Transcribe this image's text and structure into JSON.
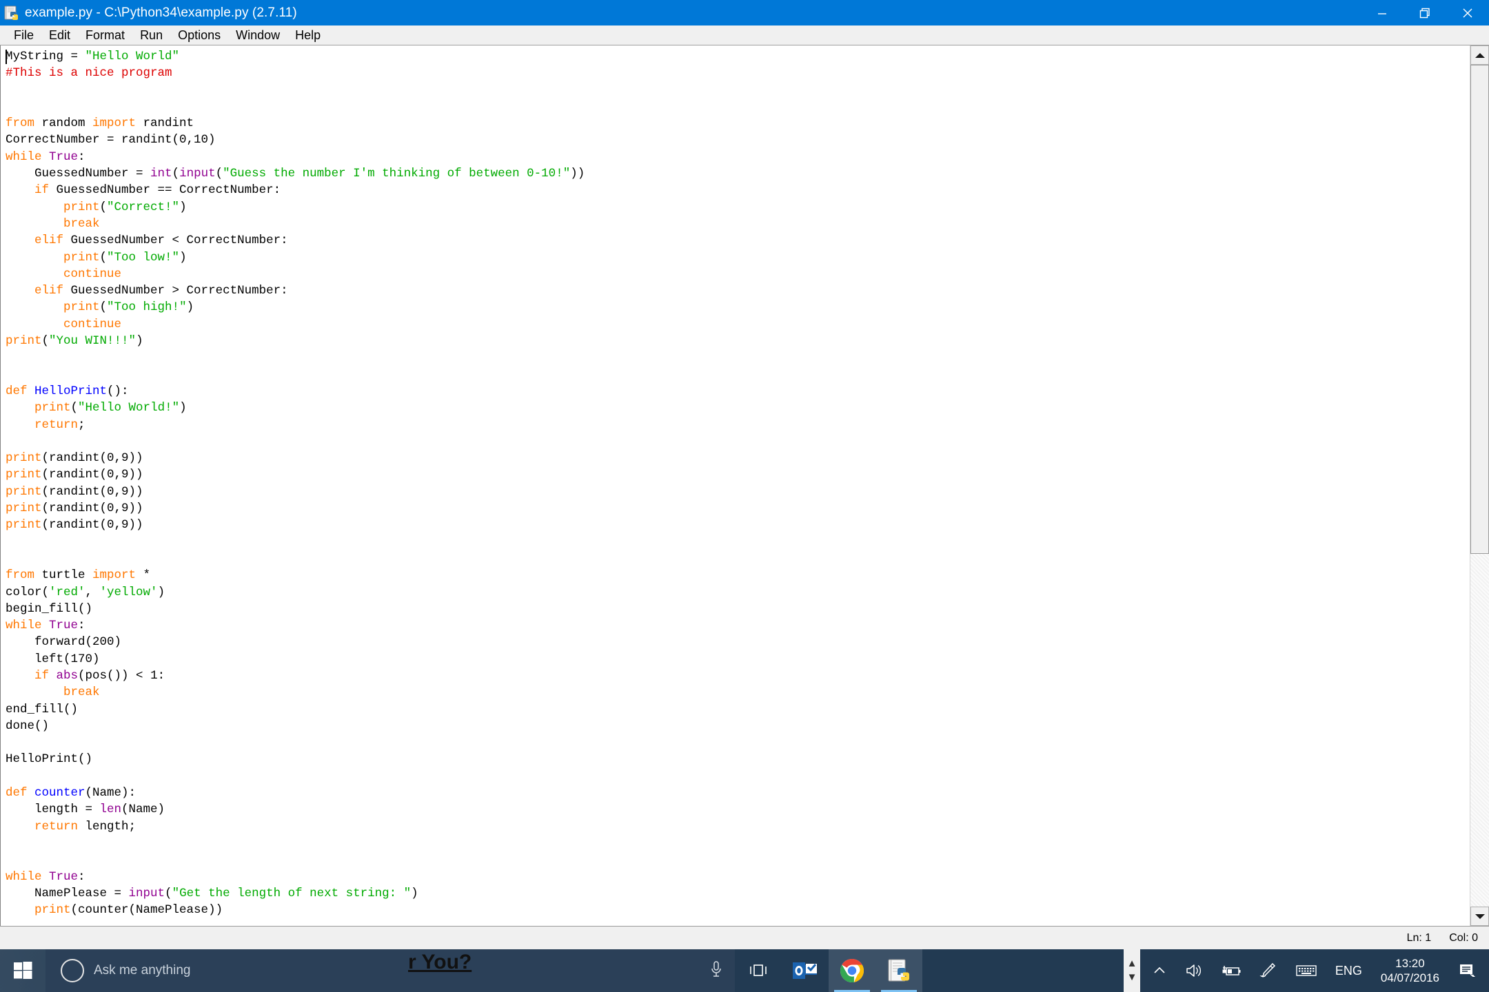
{
  "window": {
    "title": "example.py - C:\\Python34\\example.py (2.7.11)",
    "app_icon": "python-idle-icon",
    "controls": {
      "minimize": "Minimize",
      "restore": "Restore",
      "close": "Close"
    }
  },
  "menubar": {
    "items": [
      "File",
      "Edit",
      "Format",
      "Run",
      "Options",
      "Window",
      "Help"
    ]
  },
  "statusbar": {
    "line": "Ln: 1",
    "col": "Col: 0"
  },
  "editor": {
    "lines": [
      [
        [
          "MyString = ",
          "plain"
        ],
        [
          "\"Hello World\"",
          "str"
        ]
      ],
      [
        [
          "#This is a nice program",
          "com"
        ]
      ],
      [],
      [],
      [
        [
          "from ",
          "def"
        ],
        [
          "random ",
          "plain"
        ],
        [
          "import ",
          "def"
        ],
        [
          "randint",
          "plain"
        ]
      ],
      [
        [
          "CorrectNumber = randint(0,10)",
          "plain"
        ]
      ],
      [
        [
          "while ",
          "def"
        ],
        [
          "True",
          "kw2"
        ],
        [
          ":",
          "plain"
        ]
      ],
      [
        [
          "    GuessedNumber = ",
          "plain"
        ],
        [
          "int",
          "bin"
        ],
        [
          "(",
          "plain"
        ],
        [
          "input",
          "bin"
        ],
        [
          "(",
          "plain"
        ],
        [
          "\"Guess the number I'm thinking of between 0-10!\"",
          "str"
        ],
        [
          "))",
          "plain"
        ]
      ],
      [
        [
          "    ",
          "plain"
        ],
        [
          "if ",
          "def"
        ],
        [
          "GuessedNumber == CorrectNumber:",
          "plain"
        ]
      ],
      [
        [
          "        ",
          "plain"
        ],
        [
          "print",
          "call"
        ],
        [
          "(",
          "plain"
        ],
        [
          "\"Correct!\"",
          "str"
        ],
        [
          ")",
          "plain"
        ]
      ],
      [
        [
          "        ",
          "plain"
        ],
        [
          "break",
          "def"
        ]
      ],
      [
        [
          "    ",
          "plain"
        ],
        [
          "elif ",
          "def"
        ],
        [
          "GuessedNumber < CorrectNumber:",
          "plain"
        ]
      ],
      [
        [
          "        ",
          "plain"
        ],
        [
          "print",
          "call"
        ],
        [
          "(",
          "plain"
        ],
        [
          "\"Too low!\"",
          "str"
        ],
        [
          ")",
          "plain"
        ]
      ],
      [
        [
          "        ",
          "plain"
        ],
        [
          "continue",
          "def"
        ]
      ],
      [
        [
          "    ",
          "plain"
        ],
        [
          "elif ",
          "def"
        ],
        [
          "GuessedNumber > CorrectNumber:",
          "plain"
        ]
      ],
      [
        [
          "        ",
          "plain"
        ],
        [
          "print",
          "call"
        ],
        [
          "(",
          "plain"
        ],
        [
          "\"Too high!\"",
          "str"
        ],
        [
          ")",
          "plain"
        ]
      ],
      [
        [
          "        ",
          "plain"
        ],
        [
          "continue",
          "def"
        ]
      ],
      [
        [
          "print",
          "call"
        ],
        [
          "(",
          "plain"
        ],
        [
          "\"You WIN!!!\"",
          "str"
        ],
        [
          ")",
          "plain"
        ]
      ],
      [],
      [],
      [
        [
          "def ",
          "def"
        ],
        [
          "HelloPrint",
          "dfn"
        ],
        [
          "():",
          "plain"
        ]
      ],
      [
        [
          "    ",
          "plain"
        ],
        [
          "print",
          "call"
        ],
        [
          "(",
          "plain"
        ],
        [
          "\"Hello World!\"",
          "str"
        ],
        [
          ")",
          "plain"
        ]
      ],
      [
        [
          "    ",
          "plain"
        ],
        [
          "return",
          "def"
        ],
        [
          ";",
          "plain"
        ]
      ],
      [],
      [
        [
          "print",
          "call"
        ],
        [
          "(randint(0,9))",
          "plain"
        ]
      ],
      [
        [
          "print",
          "call"
        ],
        [
          "(randint(0,9))",
          "plain"
        ]
      ],
      [
        [
          "print",
          "call"
        ],
        [
          "(randint(0,9))",
          "plain"
        ]
      ],
      [
        [
          "print",
          "call"
        ],
        [
          "(randint(0,9))",
          "plain"
        ]
      ],
      [
        [
          "print",
          "call"
        ],
        [
          "(randint(0,9))",
          "plain"
        ]
      ],
      [],
      [],
      [
        [
          "from ",
          "def"
        ],
        [
          "turtle ",
          "plain"
        ],
        [
          "import ",
          "def"
        ],
        [
          "*",
          "plain"
        ]
      ],
      [
        [
          "color(",
          "plain"
        ],
        [
          "'red'",
          "str"
        ],
        [
          ", ",
          "plain"
        ],
        [
          "'yellow'",
          "str"
        ],
        [
          ")",
          "plain"
        ]
      ],
      [
        [
          "begin_fill()",
          "plain"
        ]
      ],
      [
        [
          "while ",
          "def"
        ],
        [
          "True",
          "kw2"
        ],
        [
          ":",
          "plain"
        ]
      ],
      [
        [
          "    forward(200)",
          "plain"
        ]
      ],
      [
        [
          "    left(170)",
          "plain"
        ]
      ],
      [
        [
          "    ",
          "plain"
        ],
        [
          "if ",
          "def"
        ],
        [
          "abs",
          "bin"
        ],
        [
          "(pos()) < 1:",
          "plain"
        ]
      ],
      [
        [
          "        ",
          "plain"
        ],
        [
          "break",
          "def"
        ]
      ],
      [
        [
          "end_fill()",
          "plain"
        ]
      ],
      [
        [
          "done()",
          "plain"
        ]
      ],
      [],
      [
        [
          "HelloPrint()",
          "plain"
        ]
      ],
      [],
      [
        [
          "def ",
          "def"
        ],
        [
          "counter",
          "dfn"
        ],
        [
          "(Name):",
          "plain"
        ]
      ],
      [
        [
          "    length = ",
          "plain"
        ],
        [
          "len",
          "bin"
        ],
        [
          "(Name)",
          "plain"
        ]
      ],
      [
        [
          "    ",
          "plain"
        ],
        [
          "return",
          "def"
        ],
        [
          " length;",
          "plain"
        ]
      ],
      [],
      [],
      [
        [
          "while ",
          "def"
        ],
        [
          "True",
          "kw2"
        ],
        [
          ":",
          "plain"
        ]
      ],
      [
        [
          "    NamePlease = ",
          "plain"
        ],
        [
          "input",
          "bin"
        ],
        [
          "(",
          "plain"
        ],
        [
          "\"Get the length of next string: \"",
          "str"
        ],
        [
          ")",
          "plain"
        ]
      ],
      [
        [
          "    ",
          "plain"
        ],
        [
          "print",
          "call"
        ],
        [
          "(counter(NamePlease))",
          "plain"
        ]
      ]
    ],
    "colors": {
      "keyword": "#ff7700",
      "string": "#00aa00",
      "comment": "#dd0000",
      "builtin": "#900090",
      "definition": "#0000ff",
      "plain": "#000000",
      "background": "#ffffff"
    }
  },
  "taskbar": {
    "start": "start-button",
    "search_placeholder": "Ask me anything",
    "cortana": "cortana-ring-icon",
    "mic": "microphone-icon",
    "overlay_text": "r You?",
    "apps": [
      {
        "name": "task-view",
        "icon": "task-view-icon",
        "active": false
      },
      {
        "name": "outlook",
        "icon": "outlook-icon",
        "active": false
      },
      {
        "name": "chrome",
        "icon": "chrome-icon",
        "active": true
      },
      {
        "name": "python-idle",
        "icon": "python-idle-icon",
        "active": true
      }
    ],
    "tray": {
      "show_hidden": "chevron-up-icon",
      "volume": "speaker-icon",
      "battery": "battery-charging-icon",
      "pen": "pen-icon",
      "keyboard": "touch-keyboard-icon",
      "language": "ENG",
      "time": "13:20",
      "date": "04/07/2016",
      "action_center": "action-center-icon"
    }
  }
}
